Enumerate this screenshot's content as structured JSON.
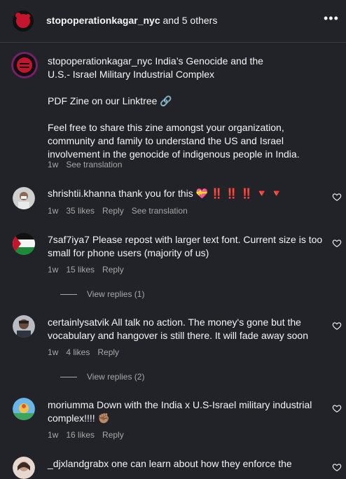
{
  "header": {
    "username": "stopoperationkagar_nyc",
    "suffix": " and 5 others",
    "more": "•••"
  },
  "caption": {
    "username": "stopoperationkagar_nyc",
    "line1": " India’s Genocide and the",
    "line2": "U.S.- Israel Military Industrial Complex",
    "para2": "PDF Zine on our Linktree 🔗",
    "para3": "Feel free to share this zine amongst your organization, community and family to understand the US and Israel involvement in the genocide of indigenous people in India.",
    "time": "1w",
    "translate": "See translation"
  },
  "comments": [
    {
      "username": "shrishtii.khanna",
      "text": " thank you for this 💝 ‼️ ‼️ ‼️ 🔻 🔻",
      "time": "1w",
      "likes": "35 likes",
      "reply": "Reply",
      "translate": "See translation"
    },
    {
      "username": "7saf7iya7",
      "text": " Please repost with larger text font. Current size is too small for phone users (majority of us)",
      "time": "1w",
      "likes": "15 likes",
      "reply": "Reply",
      "view_replies": "View replies (1)"
    },
    {
      "username": "certainlysatvik",
      "text": " All talk no action. The money's gone but the vocabulary and hangover is still there. It will fade away soon",
      "time": "1w",
      "likes": "4 likes",
      "reply": "Reply",
      "view_replies": "View replies (2)"
    },
    {
      "username": "moriumma",
      "text": " Down with the India x U.S-Israel military industrial complex!!!! ✊🏽",
      "time": "1w",
      "likes": "16 likes",
      "reply": "Reply"
    },
    {
      "username": "_djxlandgrabx",
      "text": " one can learn about how they enforce the"
    }
  ]
}
